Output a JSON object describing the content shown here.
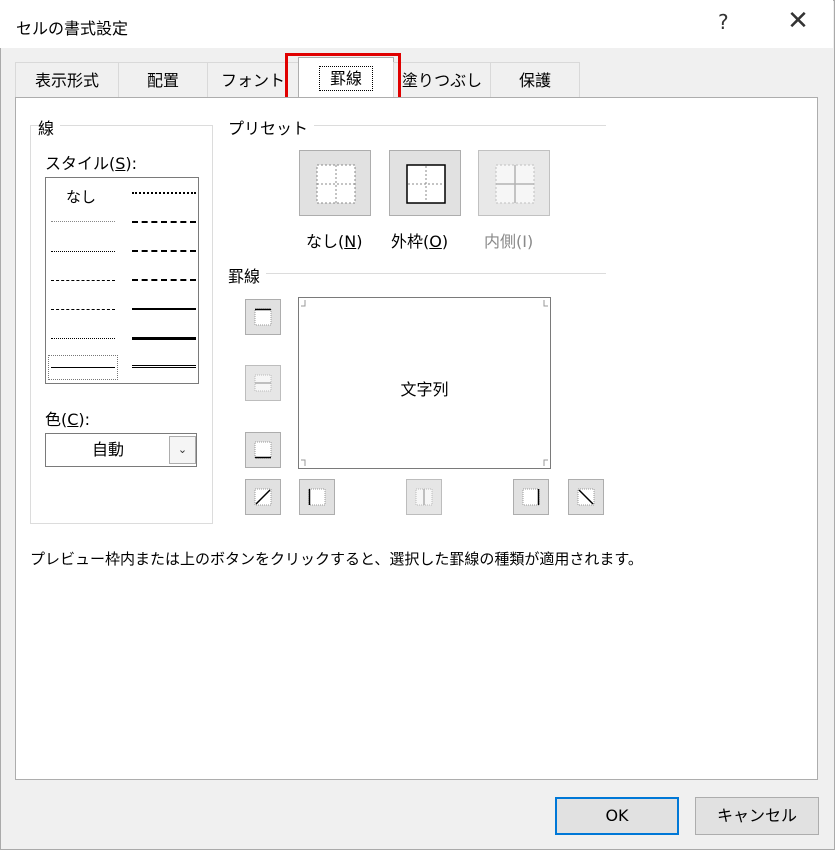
{
  "window": {
    "title": "セルの書式設定",
    "help_label": "?",
    "close_label": "✕"
  },
  "tabs": [
    {
      "label": "表示形式"
    },
    {
      "label": "配置"
    },
    {
      "label": "フォント"
    },
    {
      "label": "罫線"
    },
    {
      "label": "塗りつぶし"
    },
    {
      "label": "保護"
    }
  ],
  "active_tab": "罫線",
  "highlight_color": "#e00000",
  "line_group": {
    "label": "線",
    "style_label_prefix": "スタイル(",
    "style_label_key": "S",
    "style_label_suffix": "):",
    "none_label": "なし",
    "color_label_prefix": "色(",
    "color_label_key": "C",
    "color_label_suffix": "):",
    "color_value": "自動"
  },
  "presets": {
    "label": "プリセット",
    "none": {
      "prefix": "なし(",
      "key": "N",
      "suffix": ")"
    },
    "outline": {
      "prefix": "外枠(",
      "key": "O",
      "suffix": ")"
    },
    "inside": {
      "label": "内側(I)"
    }
  },
  "border_group": {
    "label": "罫線",
    "preview_text": "文字列"
  },
  "hint": "プレビュー枠内または上のボタンをクリックすると、選択した罫線の種類が適用されます。",
  "buttons": {
    "ok": "OK",
    "cancel": "キャンセル"
  }
}
